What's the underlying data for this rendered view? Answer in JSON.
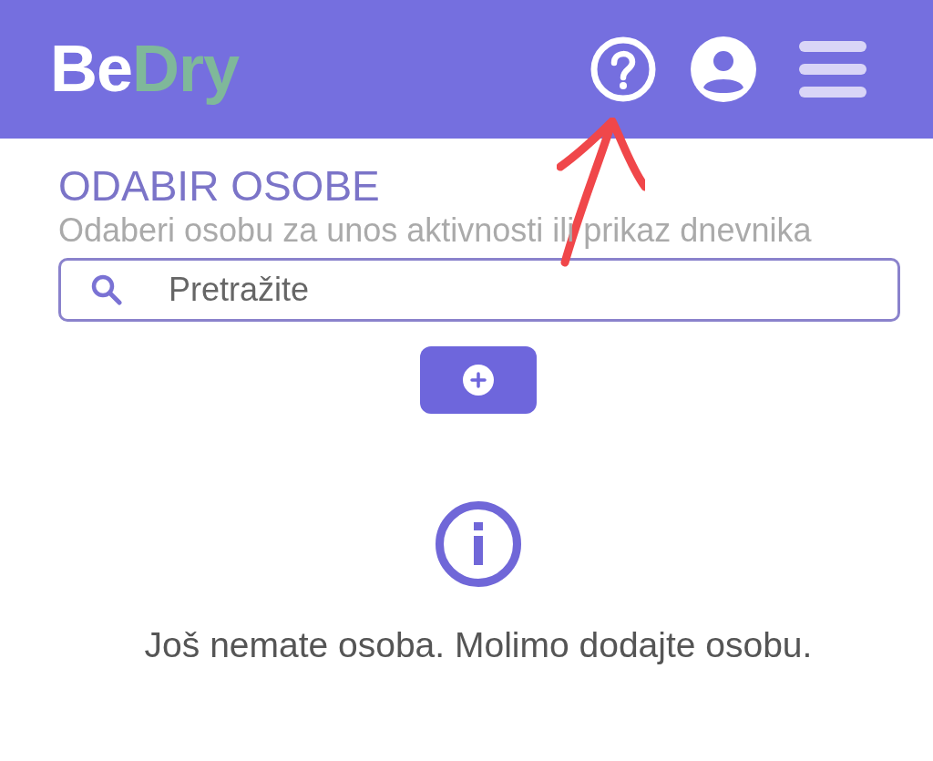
{
  "header": {
    "logo": [
      "Be",
      "Dry"
    ]
  },
  "page": {
    "title": "ODABIR OSOBE",
    "subtitle": "Odaberi osobu za unos aktivnosti ili prikaz dnevnika"
  },
  "search": {
    "placeholder": "Pretražite"
  },
  "empty_state": {
    "message": "Još nemate osoba. Molimo dodajte osobu."
  }
}
